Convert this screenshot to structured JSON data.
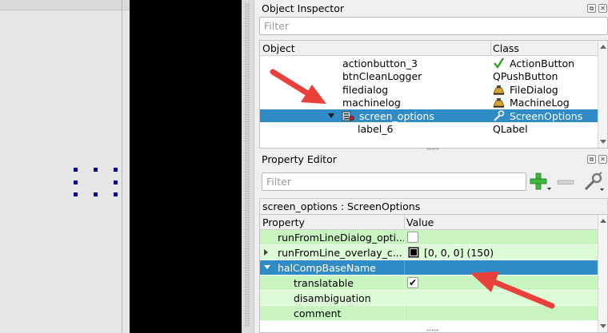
{
  "object_inspector": {
    "title": "Object Inspector",
    "filter_placeholder": "Filter",
    "headers": {
      "object": "Object",
      "class": "Class"
    },
    "rows": [
      {
        "name": "actionbutton_3",
        "class": "ActionButton",
        "icon": "checkmark-icon"
      },
      {
        "name": "btnCleanLogger",
        "class": "QPushButton",
        "icon": ""
      },
      {
        "name": "filedialog",
        "class": "FileDialog",
        "icon": "cnc-machine-icon"
      },
      {
        "name": "machinelog",
        "class": "MachineLog",
        "icon": "cnc-machine-icon"
      },
      {
        "name": "screen_options",
        "class": "ScreenOptions",
        "icon": "wrench-icon",
        "selected": true,
        "expanded": true
      },
      {
        "name": "label_6",
        "class": "QLabel",
        "icon": ""
      }
    ]
  },
  "property_editor": {
    "title": "Property Editor",
    "filter_placeholder": "Filter",
    "object_label": "screen_options : ScreenOptions",
    "headers": {
      "property": "Property",
      "value": "Value"
    },
    "rows": [
      {
        "name": "runFromLineDialog_opti...",
        "value": "",
        "kind": "checkbox",
        "checked": false
      },
      {
        "name": "runFromLine_overlay_c...",
        "value": "[0, 0, 0] (150)",
        "kind": "color",
        "expander": "collapsed",
        "swatch": "#000000"
      },
      {
        "name": "halCompBaseName",
        "value": "",
        "kind": "text",
        "expander": "expanded",
        "selected": true
      },
      {
        "name": "translatable",
        "value": "",
        "kind": "checkbox",
        "checked": true
      },
      {
        "name": "disambiguation",
        "value": "",
        "kind": "text"
      },
      {
        "name": "comment",
        "value": "",
        "kind": "text"
      }
    ]
  },
  "colors": {
    "selection": "#308cc6",
    "property_row_green": "#c8f5bf",
    "annotation_arrow": "#e8413c",
    "add_button_green": "#3cb83c"
  }
}
